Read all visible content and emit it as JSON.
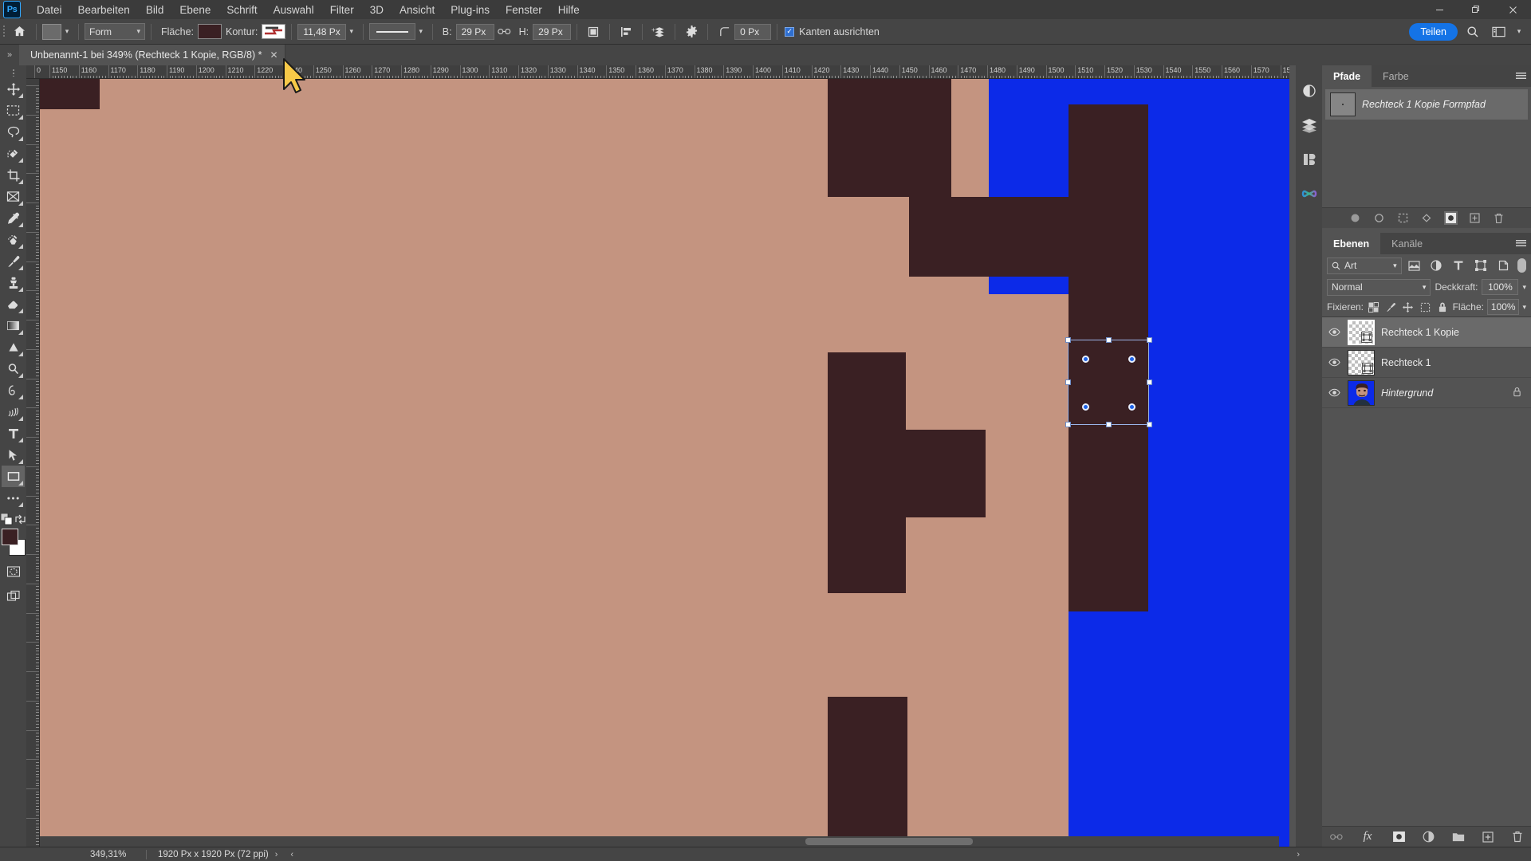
{
  "app": {
    "logo": "Ps"
  },
  "menubar": {
    "items": [
      {
        "label": "Datei"
      },
      {
        "label": "Bearbeiten"
      },
      {
        "label": "Bild"
      },
      {
        "label": "Ebene"
      },
      {
        "label": "Schrift"
      },
      {
        "label": "Auswahl"
      },
      {
        "label": "Filter"
      },
      {
        "label": "3D"
      },
      {
        "label": "Ansicht"
      },
      {
        "label": "Plug-ins"
      },
      {
        "label": "Fenster"
      },
      {
        "label": "Hilfe"
      }
    ],
    "window_controls": {
      "minimize": "—",
      "maximize": "❐",
      "close": "✕"
    }
  },
  "options_bar": {
    "home_icon": "home-icon",
    "shape_preset_label": "shape-preset",
    "mode_value": "Form",
    "fill_label": "Fläche:",
    "fill_color": "#3a2023",
    "stroke_label": "Kontur:",
    "stroke_width": "11,48 Px",
    "stroke_style_label": "stroke-style",
    "width_label": "B:",
    "width_value": "29 Px",
    "link_icon": "link-icon",
    "height_label": "H:",
    "height_value": "29 Px",
    "path_ops_icon": "path-operations-icon",
    "align_icon": "path-alignment-icon",
    "arrange_icon": "path-arrangement-icon",
    "gear_icon": "settings-gear-icon",
    "radius_icon": "corner-radius-icon",
    "radius_value": "0 Px",
    "snap_checked": true,
    "snap_label": "Kanten ausrichten",
    "share_label": "Teilen",
    "search_icon": "search-icon",
    "workspace_icon": "workspace-icon",
    "workspace_caret": "⌄"
  },
  "document_tab": {
    "title": "Unbenannt-1 bei 349% (Rechteck 1 Kopie, RGB/8) *",
    "close": "✕",
    "chevron": "»"
  },
  "toolbar": {
    "tools": [
      {
        "name": "move-tool",
        "glyph": "move"
      },
      {
        "name": "marquee-tool",
        "glyph": "marquee"
      },
      {
        "name": "lasso-tool",
        "glyph": "lasso"
      },
      {
        "name": "quick-selection-tool",
        "glyph": "quickselect"
      },
      {
        "name": "crop-tool",
        "glyph": "crop"
      },
      {
        "name": "frame-tool",
        "glyph": "frame"
      },
      {
        "name": "eyedropper-tool",
        "glyph": "eyedropper"
      },
      {
        "name": "spot-healing-tool",
        "glyph": "healing"
      },
      {
        "name": "brush-tool",
        "glyph": "brush"
      },
      {
        "name": "clone-stamp-tool",
        "glyph": "stamp"
      },
      {
        "name": "eraser-tool",
        "glyph": "eraser"
      },
      {
        "name": "gradient-tool",
        "glyph": "gradient"
      },
      {
        "name": "blur-tool",
        "glyph": "blur"
      },
      {
        "name": "dodge-tool",
        "glyph": "dodge"
      },
      {
        "name": "pen-tool",
        "glyph": "pen"
      },
      {
        "name": "history-brush-tool",
        "glyph": "historybrush"
      },
      {
        "name": "type-tool",
        "glyph": "type"
      },
      {
        "name": "path-selection-tool",
        "glyph": "pathselect"
      },
      {
        "name": "rectangle-tool",
        "glyph": "rectangle",
        "active": true
      },
      {
        "name": "more-tools",
        "glyph": "more"
      }
    ],
    "quickmask_icon": "quick-mask-icon",
    "screenmode_icon": "screen-mode-icon",
    "swap_icon": "swap-colors-icon",
    "default_icon": "default-colors-icon",
    "foreground_color": "#3a2023",
    "background_color": "#ffffff"
  },
  "rulers": {
    "h_labels": [
      "0",
      "1150",
      "1160",
      "1170",
      "1180",
      "1190",
      "1200",
      "1210",
      "1220",
      "1240",
      "1250",
      "1260",
      "1270",
      "1280",
      "1290",
      "1300",
      "1310",
      "1320",
      "1330",
      "1340",
      "1350",
      "1360",
      "1370",
      "1380",
      "1390",
      "1400",
      "1410",
      "1420",
      "1430",
      "1440",
      "1450",
      "1460",
      "1470",
      "1480",
      "1490",
      "1500",
      "1510",
      "1520",
      "1530",
      "1540",
      "1550",
      "1560",
      "1570",
      "15"
    ],
    "unit": "Px"
  },
  "canvas": {
    "background_color": "#c49480",
    "shape_color": "#3a2023",
    "blue_color": "#0c2ae8",
    "selection": {
      "handles": 8,
      "anchors": 4,
      "border_color": "#9ab4e8",
      "handle_color": "#ffffff",
      "anchor_color": "#1e63e8"
    },
    "cursor": "arrow-cursor"
  },
  "status_bar": {
    "zoom": "349,31%",
    "dimensions": "1920 Px x 1920 Px (72 ppi)",
    "next_arrow": "›",
    "prev_arrow": "‹",
    "right_arrow": "›"
  },
  "dock_strip": {
    "icons": [
      {
        "name": "adjustments-icon"
      },
      {
        "name": "layers-comps-icon"
      },
      {
        "name": "properties-icon"
      },
      {
        "name": "gradients-icon"
      }
    ]
  },
  "paths_panel": {
    "tabs": [
      {
        "label": "Pfade",
        "active": true
      },
      {
        "label": "Farbe",
        "active": false
      }
    ],
    "menu_icon": "panel-menu-icon",
    "path_name": "Rechteck 1 Kopie Formpfad",
    "footer_icons": [
      {
        "name": "fill-path-icon"
      },
      {
        "name": "stroke-path-icon"
      },
      {
        "name": "load-selection-icon"
      },
      {
        "name": "make-work-path-icon"
      },
      {
        "name": "add-mask-icon"
      },
      {
        "name": "new-path-icon"
      },
      {
        "name": "delete-path-icon"
      }
    ]
  },
  "layers_panel": {
    "tabs": [
      {
        "label": "Ebenen",
        "active": true
      },
      {
        "label": "Kanäle",
        "active": false
      }
    ],
    "menu_icon": "panel-menu-icon",
    "filter_label": "Art",
    "filter_search_icon": "search-icon",
    "filter_icons": [
      {
        "name": "filter-pixel-icon"
      },
      {
        "name": "filter-adjustment-icon"
      },
      {
        "name": "filter-type-icon"
      },
      {
        "name": "filter-shape-icon"
      },
      {
        "name": "filter-smart-object-icon"
      }
    ],
    "blend_mode": "Normal",
    "opacity_label": "Deckkraft:",
    "opacity_value": "100%",
    "lock_label": "Fixieren:",
    "lock_icons": [
      {
        "name": "lock-transparency-icon"
      },
      {
        "name": "lock-image-icon"
      },
      {
        "name": "lock-position-icon"
      },
      {
        "name": "lock-artboard-icon"
      },
      {
        "name": "lock-all-icon"
      }
    ],
    "fill_label": "Fläche:",
    "fill_value": "100%",
    "layers": [
      {
        "name": "Rechteck 1 Kopie",
        "selected": true,
        "visible": true,
        "locked": false,
        "type": "shape",
        "italic": false
      },
      {
        "name": "Rechteck 1",
        "selected": false,
        "visible": true,
        "locked": false,
        "type": "shape",
        "italic": false
      },
      {
        "name": "Hintergrund",
        "selected": false,
        "visible": true,
        "locked": true,
        "type": "image",
        "italic": true
      }
    ],
    "footer_icons": [
      {
        "name": "link-layers-icon",
        "glyph": "link"
      },
      {
        "name": "layer-style-icon",
        "glyph": "fx"
      },
      {
        "name": "layer-mask-icon",
        "glyph": "mask"
      },
      {
        "name": "adjustment-layer-icon",
        "glyph": "adj"
      },
      {
        "name": "new-group-icon",
        "glyph": "folder"
      },
      {
        "name": "new-layer-icon",
        "glyph": "plus"
      },
      {
        "name": "delete-layer-icon",
        "glyph": "trash"
      }
    ]
  }
}
